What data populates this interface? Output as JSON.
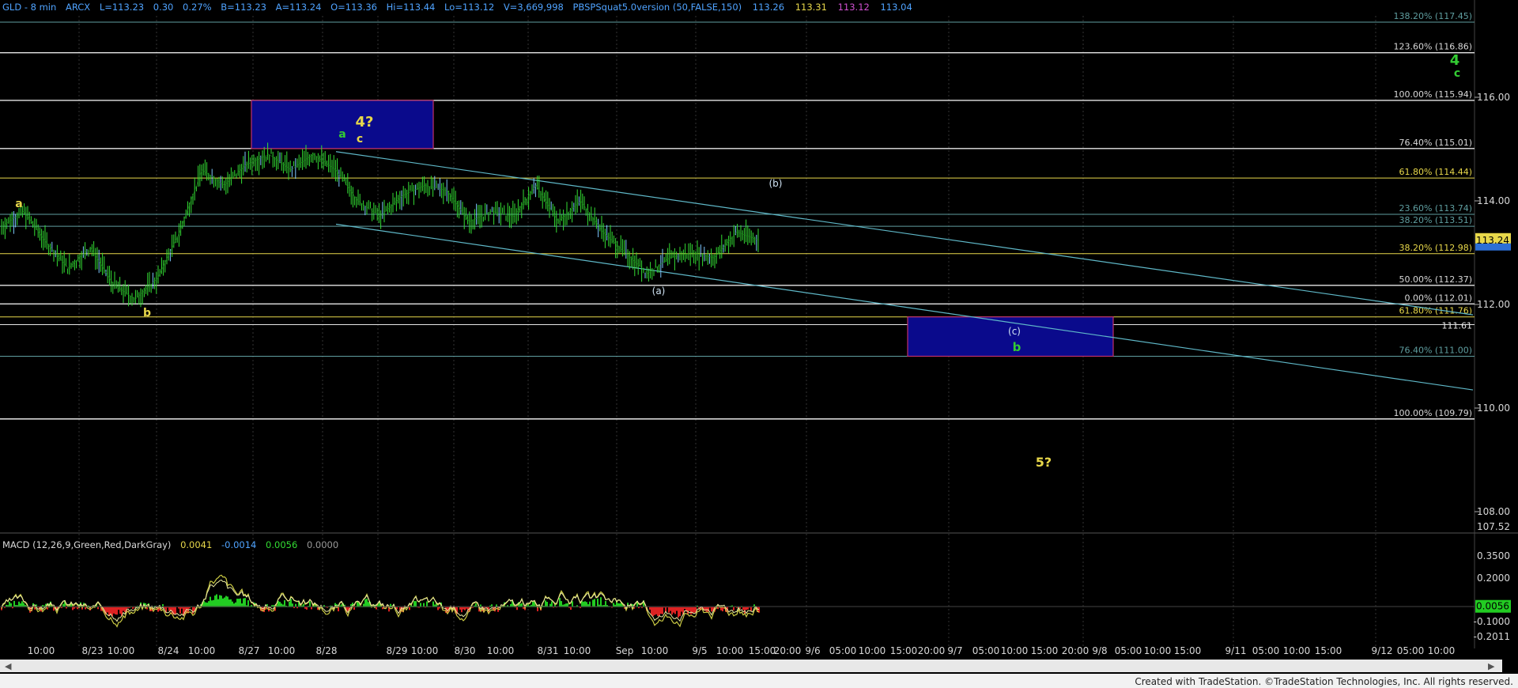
{
  "header": {
    "symbol": "GLD - 8 min",
    "exchange": "ARCX",
    "last": "L=113.23",
    "change": "0.30",
    "change_pct": "0.27%",
    "bid": "B=113.23",
    "ask": "A=113.24",
    "open": "O=113.36",
    "high": "Hi=113.44",
    "low": "Lo=113.12",
    "volume": "V=3,669,998",
    "indicator": "PBSPSquat5.0version (50,FALSE,150)",
    "ind_values": [
      {
        "text": "113.26",
        "color": "#4fa3ff"
      },
      {
        "text": "113.31",
        "color": "#e8d84a"
      },
      {
        "text": "113.12",
        "color": "#d050d0"
      },
      {
        "text": "113.04",
        "color": "#4fa3ff"
      }
    ]
  },
  "macd_header": {
    "name": "MACD (12,26,9,Green,Red,DarkGray)",
    "values": [
      {
        "text": "0.0041",
        "color": "#e8d84a"
      },
      {
        "text": "-0.0014",
        "color": "#4fa3ff"
      },
      {
        "text": "0.0056",
        "color": "#33dd33"
      },
      {
        "text": "0.0000",
        "color": "#999999"
      }
    ]
  },
  "footer": "Created with TradeStation. ©TradeStation Technologies, Inc. All rights reserved.",
  "price_axis": {
    "ticks": [
      "116.00",
      "114.00",
      "112.00",
      "110.00",
      "108.00"
    ],
    "range_low": "107.52",
    "last_price": "113.24",
    "line_label": "111.61",
    "line_label_value": 111.61
  },
  "macd_axis": {
    "ticks": [
      "0.3500",
      "0.2000",
      "-0.1000",
      "-0.2011"
    ],
    "last": "0.0056"
  },
  "time_axis": [
    "10:00",
    "8/23",
    "10:00",
    "8/24",
    "10:00",
    "8/27",
    "10:00",
    "8/28",
    "8/29",
    "10:00",
    "8/30",
    "10:00",
    "8/31",
    "10:00",
    "Sep",
    "10:00",
    "9/5",
    "10:00",
    "15:00",
    "20:00",
    "9/6",
    "05:00",
    "10:00",
    "15:00",
    "20:00",
    "9/7",
    "05:00",
    "10:00",
    "15:00",
    "20:00",
    "9/8",
    "05:00",
    "10:00",
    "15:00",
    "9/11",
    "05:00",
    "10:00",
    "15:00",
    "9/12",
    "05:00",
    "10:00"
  ],
  "fib_levels": [
    {
      "label": "138.20% (117.45)",
      "value": 117.45,
      "color": "#5f9ea0"
    },
    {
      "label": "123.60% (116.86)",
      "value": 116.86,
      "color": "#d8d8d8"
    },
    {
      "label": "100.00% (115.94)",
      "value": 115.94,
      "color": "#d8d8d8"
    },
    {
      "label": "76.40% (115.01)",
      "value": 115.01,
      "color": "#d8d8d8"
    },
    {
      "label": "61.80% (114.44)",
      "value": 114.44,
      "color": "#e8d84a"
    },
    {
      "label": "23.60% (113.74)",
      "value": 113.74,
      "color": "#5f9ea0"
    },
    {
      "label": "38.20% (113.51)",
      "value": 113.51,
      "color": "#5f9ea0"
    },
    {
      "label": "38.20% (112.98)",
      "value": 112.98,
      "color": "#e8d84a"
    },
    {
      "label": "50.00% (112.37)",
      "value": 112.37,
      "color": "#d8d8d8"
    },
    {
      "label": "0.00% (112.01)",
      "value": 112.01,
      "color": "#d8d8d8"
    },
    {
      "label": "61.80% (111.76)",
      "value": 111.76,
      "color": "#e8d84a"
    },
    {
      "label": "76.40% (111.00)",
      "value": 111.0,
      "color": "#5f9ea0"
    },
    {
      "label": "100.00% (109.79)",
      "value": 109.79,
      "color": "#d8d8d8"
    }
  ],
  "wave_labels": [
    {
      "text": "a",
      "color": "#e8d84a",
      "size": 14,
      "bold": true
    },
    {
      "text": "b",
      "color": "#e8d84a",
      "size": 14,
      "bold": true
    },
    {
      "text": "a",
      "color": "#33cc33",
      "size": 14,
      "bold": true
    },
    {
      "text": "c",
      "color": "#e8d84a",
      "size": 14,
      "bold": true
    },
    {
      "text": "4?",
      "color": "#e8d84a",
      "size": 18,
      "bold": true
    },
    {
      "text": "(b)",
      "color": "#cfe2f3",
      "size": 12,
      "bold": false
    },
    {
      "text": "(a)",
      "color": "#cfe2f3",
      "size": 12,
      "bold": false
    },
    {
      "text": "(c)",
      "color": "#cfe2f3",
      "size": 12,
      "bold": false
    },
    {
      "text": "b",
      "color": "#33cc33",
      "size": 15,
      "bold": true
    },
    {
      "text": "4",
      "color": "#33cc33",
      "size": 18,
      "bold": true
    },
    {
      "text": "c",
      "color": "#33cc33",
      "size": 14,
      "bold": true
    },
    {
      "text": "5?",
      "color": "#e8d84a",
      "size": 16,
      "bold": true
    }
  ],
  "chart_data": {
    "type": "line",
    "symbol": "GLD",
    "interval": "8 min",
    "price_series": [
      {
        "t": "8/22",
        "v": 113.5
      },
      {
        "t": "8/22",
        "v": 113.8
      },
      {
        "t": "8/22",
        "v": 113.2
      },
      {
        "t": "8/23",
        "v": 112.7
      },
      {
        "t": "8/23",
        "v": 113.1
      },
      {
        "t": "8/23",
        "v": 112.4
      },
      {
        "t": "8/23",
        "v": 112.1
      },
      {
        "t": "8/24",
        "v": 112.5
      },
      {
        "t": "8/24",
        "v": 113.4
      },
      {
        "t": "8/24",
        "v": 114.6
      },
      {
        "t": "8/24",
        "v": 114.3
      },
      {
        "t": "8/27",
        "v": 114.7
      },
      {
        "t": "8/27",
        "v": 114.9
      },
      {
        "t": "8/27",
        "v": 114.6
      },
      {
        "t": "8/27",
        "v": 114.9
      },
      {
        "t": "8/28",
        "v": 114.6
      },
      {
        "t": "8/28",
        "v": 114.0
      },
      {
        "t": "8/28",
        "v": 113.7
      },
      {
        "t": "8/29",
        "v": 114.1
      },
      {
        "t": "8/29",
        "v": 114.3
      },
      {
        "t": "8/29",
        "v": 114.2
      },
      {
        "t": "8/30",
        "v": 113.6
      },
      {
        "t": "8/30",
        "v": 113.8
      },
      {
        "t": "8/30",
        "v": 113.7
      },
      {
        "t": "8/31",
        "v": 114.3
      },
      {
        "t": "8/31",
        "v": 113.6
      },
      {
        "t": "8/31",
        "v": 114.0
      },
      {
        "t": "8/31",
        "v": 113.4
      },
      {
        "t": "9/4",
        "v": 113.0
      },
      {
        "t": "9/4",
        "v": 112.6
      },
      {
        "t": "9/4",
        "v": 112.9
      },
      {
        "t": "9/4",
        "v": 113.0
      },
      {
        "t": "9/5",
        "v": 112.9
      },
      {
        "t": "9/5",
        "v": 113.4
      },
      {
        "t": "9/5",
        "v": 113.24
      }
    ],
    "ylim": [
      107.3,
      117.6
    ],
    "macd_ylim": [
      -0.24,
      0.4
    ],
    "boxes": [
      {
        "name": "4? zone",
        "high": 115.94,
        "low": 115.01
      },
      {
        "name": "b zone",
        "high": 111.76,
        "low": 111.0
      }
    ],
    "channel_lines": [
      {
        "from": {
          "t": "8/28",
          "v": 114.95
        },
        "to": {
          "t": "9/12",
          "v": 111.8
        }
      },
      {
        "from": {
          "t": "8/28",
          "v": 113.55
        },
        "to": {
          "t": "9/12",
          "v": 110.35
        }
      }
    ],
    "grid": true,
    "legend": "none"
  }
}
